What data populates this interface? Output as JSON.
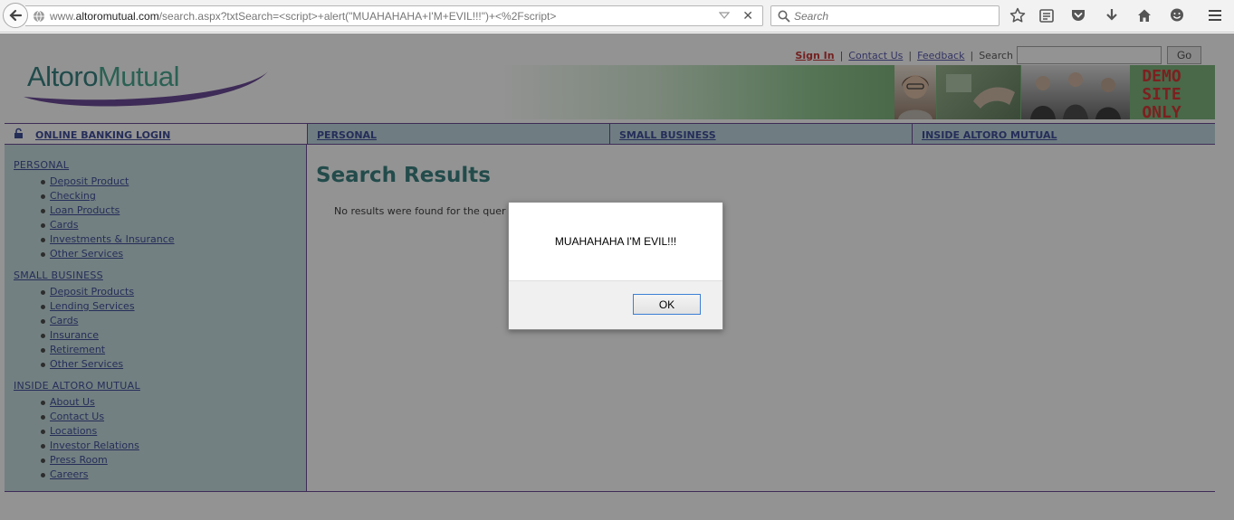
{
  "browser": {
    "url_prefix": "www.",
    "url_domain": "altoromutual.com",
    "url_path": "/search.aspx?txtSearch=<script>+alert(\"MUAHAHAHA+I'M+EVIL!!!\")+<%2Fscript>",
    "search_placeholder": "Search",
    "icons": [
      "back-icon",
      "globe-icon",
      "dropdown-icon",
      "close-icon",
      "search-icon",
      "bookmark-star-icon",
      "reading-list-icon",
      "pocket-icon",
      "download-icon",
      "home-icon",
      "chat-icon",
      "menu-icon"
    ]
  },
  "site": {
    "logo_part1": "Altoro",
    "logo_part2": "Mutual",
    "top_links": {
      "sign_in": "Sign In",
      "contact": "Contact Us",
      "feedback": "Feedback",
      "search_label": "Search",
      "go": "Go"
    },
    "demo_line1": "DEMO",
    "demo_line2": "SITE",
    "demo_line3": "ONLY",
    "colors": {
      "teal": "#1f6f6f",
      "purple": "#552e86",
      "nav_bg": "#b6d3dc",
      "sidebar_bg": "#bfd9da",
      "demo_red": "#d01818"
    }
  },
  "nav": {
    "login": "ONLINE BANKING LOGIN",
    "personal": "PERSONAL",
    "small_business": "SMALL BUSINESS",
    "inside": "INSIDE ALTORO MUTUAL"
  },
  "sidebar": {
    "personal": {
      "heading": "PERSONAL",
      "items": [
        "Deposit Product",
        "Checking",
        "Loan Products",
        "Cards",
        "Investments & Insurance",
        "Other Services"
      ]
    },
    "small_business": {
      "heading": "SMALL BUSINESS",
      "items": [
        "Deposit Products",
        "Lending Services",
        "Cards",
        "Insurance",
        "Retirement",
        "Other Services"
      ]
    },
    "inside": {
      "heading": "INSIDE ALTORO MUTUAL",
      "items": [
        "About Us",
        "Contact Us",
        "Locations",
        "Investor Relations",
        "Press Room",
        "Careers"
      ]
    }
  },
  "main": {
    "title": "Search Results",
    "message": "No results were found for the quer"
  },
  "dialog": {
    "message": "MUAHAHAHA I'M EVIL!!!",
    "ok": "OK"
  }
}
